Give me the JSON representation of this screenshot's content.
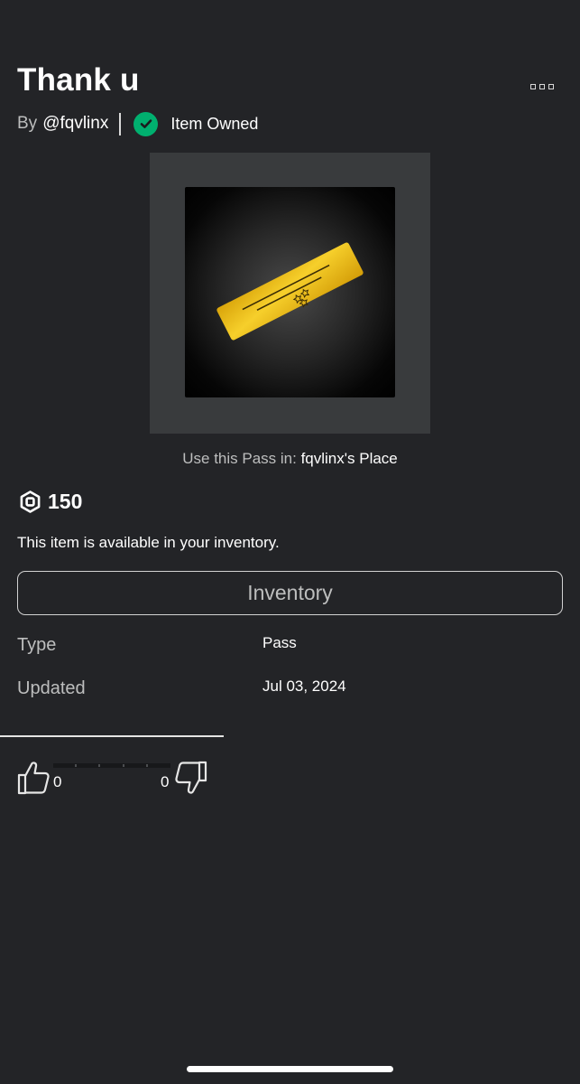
{
  "item": {
    "title": "Thank u",
    "by_prefix": "By",
    "creator": "@fqvlinx",
    "owned_label": "Item Owned"
  },
  "use_pass": {
    "label": "Use this Pass in:",
    "place": "fqvlinx's Place"
  },
  "price": {
    "value": "150",
    "icon": "robux-icon"
  },
  "availability_text": "This item is available in your inventory.",
  "inventory_button": "Inventory",
  "details": [
    {
      "label": "Type",
      "value": "Pass"
    },
    {
      "label": "Updated",
      "value": "Jul 03, 2024"
    }
  ],
  "votes": {
    "up_count": "0",
    "down_count": "0"
  },
  "colors": {
    "background": "#232427",
    "owned_green": "#00b06f",
    "pass_gold": "#f2c21b",
    "muted_text": "#bdbebe"
  }
}
